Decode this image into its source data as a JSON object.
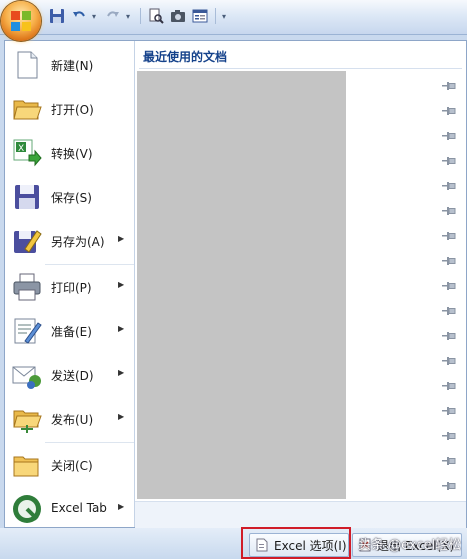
{
  "menu": {
    "items": [
      {
        "label": "新建(N)",
        "icon": "new-document-icon",
        "arrow": ""
      },
      {
        "label": "打开(O)",
        "icon": "open-folder-icon",
        "arrow": ""
      },
      {
        "label": "转换(V)",
        "icon": "convert-icon",
        "arrow": ""
      },
      {
        "label": "保存(S)",
        "icon": "save-icon",
        "arrow": ""
      },
      {
        "label": "另存为(A)",
        "icon": "save-as-icon",
        "arrow": "▶"
      },
      {
        "label": "打印(P)",
        "icon": "printer-icon",
        "arrow": "▶"
      },
      {
        "label": "准备(E)",
        "icon": "prepare-icon",
        "arrow": "▶"
      },
      {
        "label": "发送(D)",
        "icon": "send-icon",
        "arrow": "▶"
      },
      {
        "label": "发布(U)",
        "icon": "publish-icon",
        "arrow": "▶"
      },
      {
        "label": "关闭(C)",
        "icon": "close-folder-icon",
        "arrow": ""
      },
      {
        "label": "Excel Tab",
        "icon": "excel-tab-icon",
        "arrow": "▶"
      }
    ]
  },
  "recent": {
    "title": "最近使用的文档",
    "pin_icon": "pin-icon"
  },
  "bottom": {
    "options_label": "Excel 选项(I)",
    "exit_label": "退出 Excel(X)"
  },
  "watermark": "头条 @excel轻松",
  "colors": {
    "highlight": "#d01c28",
    "title_text": "#15428b",
    "redacted": "#c4c4c4"
  }
}
